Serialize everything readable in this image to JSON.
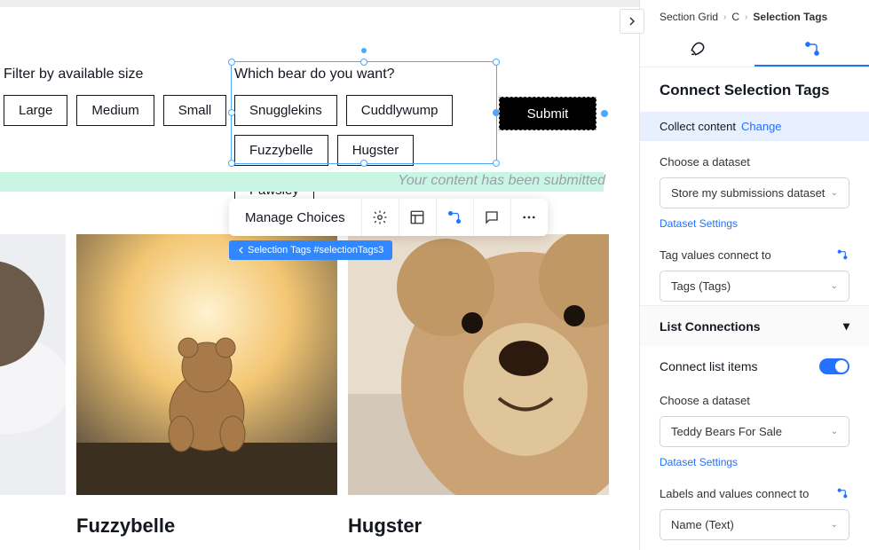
{
  "breadcrumb": {
    "root": "Section Grid",
    "mid": "C",
    "leaf": "Selection Tags"
  },
  "panel": {
    "title": "Connect Selection Tags",
    "collect": {
      "label": "Collect content",
      "action": "Change"
    },
    "chooseDataset": "Choose a dataset",
    "dataset1": "Store my submissions dataset",
    "datasetSettings": "Dataset Settings",
    "tagValuesLabel": "Tag values connect to",
    "tagValuesValue": "Tags (Tags)",
    "listConnections": "List Connections",
    "connectListItems": "Connect list items",
    "dataset2": "Teddy Bears For Sale",
    "labelsConnect": "Labels and values connect to",
    "labelsValue": "Name (Text)"
  },
  "toolbar": {
    "manage": "Manage Choices"
  },
  "badge": {
    "text": "Selection Tags #selectionTags3"
  },
  "form": {
    "filterLabel": "Filter by available size",
    "filterOptions": [
      "Large",
      "Medium",
      "Small"
    ],
    "bearLabel": "Which bear do you want?",
    "bearOptions": [
      "Snugglekins",
      "Cuddlywump",
      "Fuzzybelle",
      "Hugster",
      "Pawsley"
    ],
    "submit": "Submit",
    "submittedMsg": "Your content has been submitted"
  },
  "gallery": {
    "items": [
      {
        "title": ""
      },
      {
        "title": "Fuzzybelle"
      },
      {
        "title": "Hugster"
      }
    ]
  }
}
